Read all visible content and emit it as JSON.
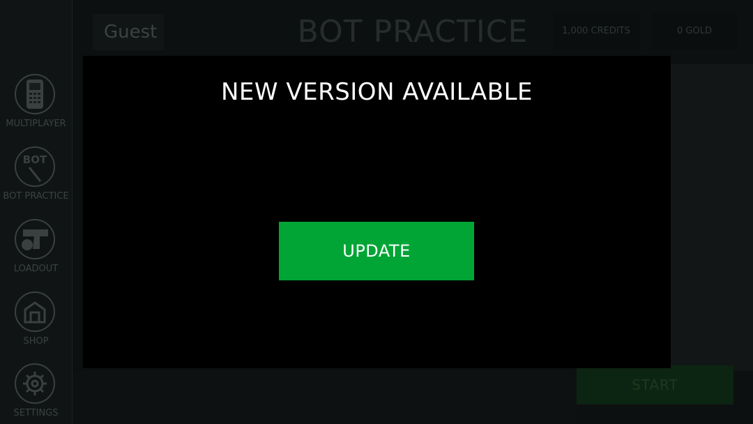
{
  "sidebar": {
    "items": [
      {
        "label": "MULTIPLAYER",
        "icon": "phone-icon"
      },
      {
        "label": "BOT PRACTICE",
        "icon": "bot-icon",
        "icon_text": "BOT"
      },
      {
        "label": "LOADOUT",
        "icon": "pistol-icon"
      },
      {
        "label": "SHOP",
        "icon": "shop-box-icon"
      },
      {
        "label": "SETTINGS",
        "icon": "gear-icon"
      }
    ]
  },
  "header": {
    "user": "Guest",
    "title": "BOT PRACTICE",
    "credits": "1,000 CREDITS",
    "gold": "0 GOLD"
  },
  "actions": {
    "start_label": "START"
  },
  "modal": {
    "title": "NEW VERSION AVAILABLE",
    "update_label": "UPDATE"
  },
  "colors": {
    "update_green": "#00a535",
    "modal_bg": "#000000",
    "title_text": "#ffffff"
  }
}
